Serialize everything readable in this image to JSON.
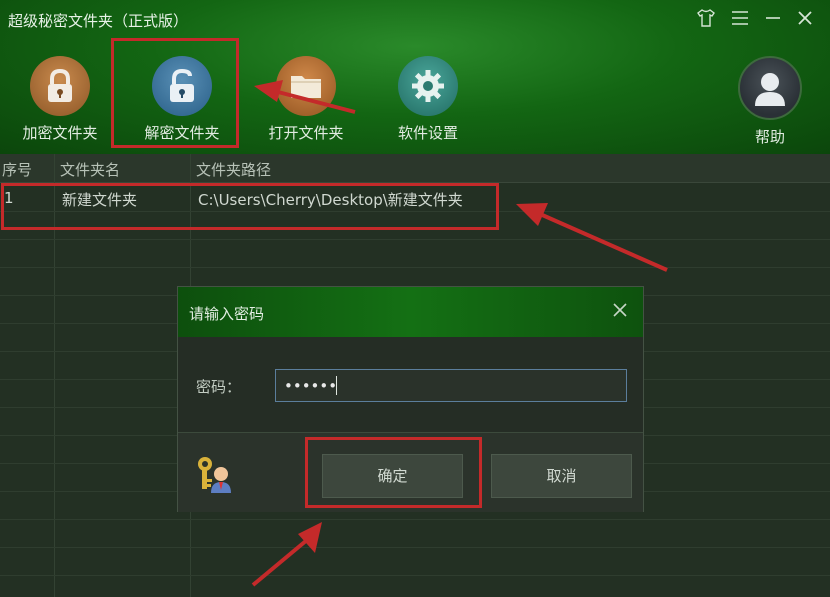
{
  "app": {
    "title": "超级秘密文件夹（正式版）"
  },
  "window_controls": {
    "skin_icon": "tshirt-icon",
    "menu_icon": "hamburger-menu-icon",
    "minimize_icon": "minimize-icon",
    "close_icon": "close-icon"
  },
  "toolbar": {
    "encrypt_label": "加密文件夹",
    "decrypt_label": "解密文件夹",
    "open_label": "打开文件夹",
    "settings_label": "软件设置",
    "help_label": "帮助"
  },
  "table": {
    "columns": [
      "序号",
      "文件夹名",
      "文件夹路径"
    ],
    "rows": [
      {
        "index": "1",
        "name": "新建文件夹",
        "path": "C:\\Users\\Cherry\\Desktop\\新建文件夹"
      }
    ]
  },
  "dialog": {
    "title": "请输入密码",
    "password_label": "密码：",
    "password_value": "••••••",
    "confirm_label": "确定",
    "cancel_label": "取消"
  },
  "colors": {
    "header_green": "#136613",
    "annotation_red": "#c42a2a",
    "input_border": "#5b7e9c"
  }
}
